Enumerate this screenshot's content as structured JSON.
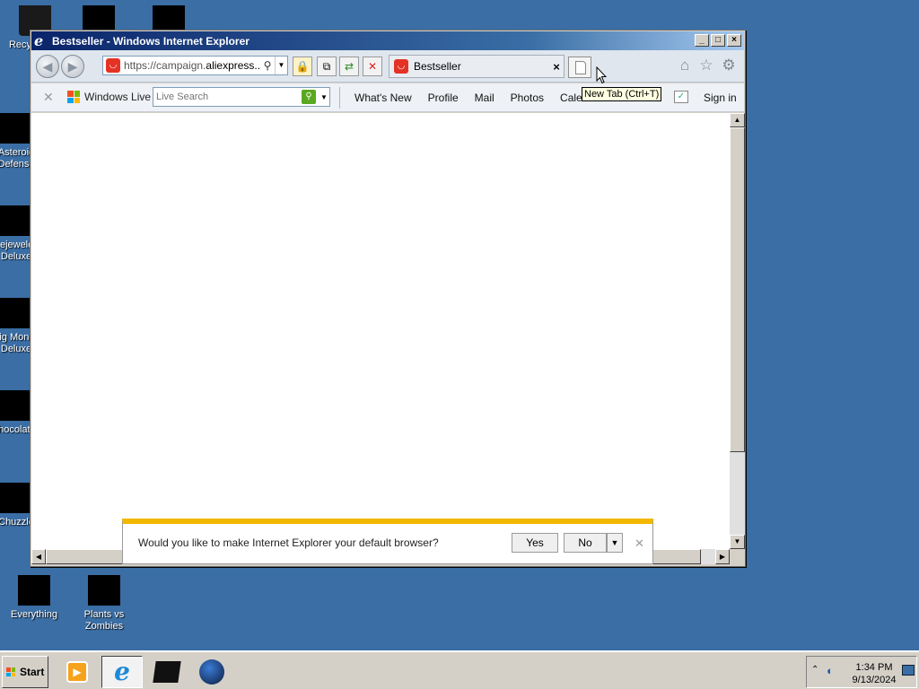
{
  "desktop": {
    "icons": [
      {
        "label": "Recycle Bin"
      },
      {
        "label": "Asteroid Defense"
      },
      {
        "label": "Bejeweled Deluxe"
      },
      {
        "label": "Big Money Deluxe"
      },
      {
        "label": "Chocolatier"
      },
      {
        "label": "Chuzzle"
      },
      {
        "label": "Everything"
      },
      {
        "label": "Plants vs Zombies"
      }
    ],
    "background_color": "#3a6ea5"
  },
  "window": {
    "title": "Bestseller - Windows Internet Explorer",
    "controls": {
      "minimize": "_",
      "maximize": "□",
      "close": "×"
    }
  },
  "navbar": {
    "address": {
      "prefix": "https://campaign.",
      "domain": "aliexpress...",
      "favicon": "aliexpress-icon"
    },
    "tab": {
      "title": "Bestseller",
      "close": "×"
    },
    "tooltip": "New Tab (Ctrl+T)"
  },
  "livebar": {
    "brand": "Windows Live",
    "search_placeholder": "Live Search",
    "links": [
      "What's New",
      "Profile",
      "Mail",
      "Photos",
      "Calendar"
    ],
    "signin": "Sign in"
  },
  "notification": {
    "message": "Would you like to make Internet Explorer your default browser?",
    "yes": "Yes",
    "no": "No",
    "accent": "#f2b800"
  },
  "taskbar": {
    "start": "Start",
    "clock_time": "1:34 PM",
    "clock_date": "9/13/2024"
  }
}
